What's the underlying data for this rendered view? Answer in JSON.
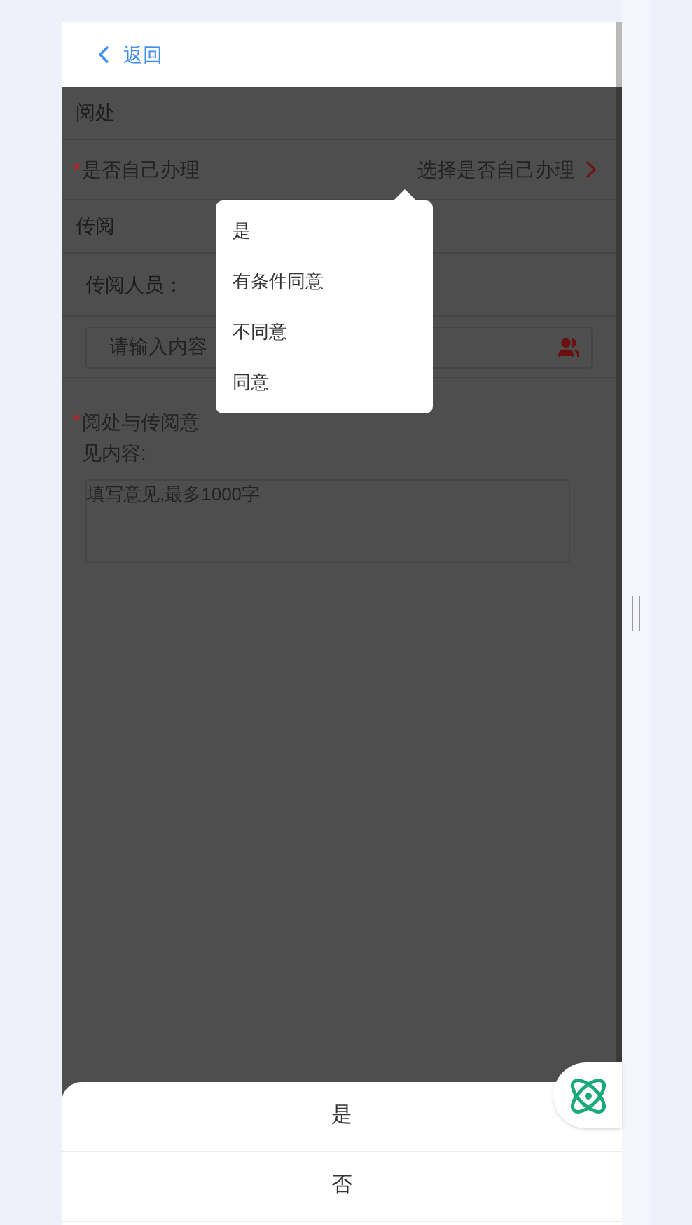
{
  "back": "返回",
  "form": {
    "section_1": "阅处",
    "handle_self": {
      "label": "是否自己办理",
      "required_mark": "*",
      "placeholder": "选择是否自己办理"
    },
    "section_2": "传阅",
    "recipients": {
      "label": "传阅人员：",
      "placeholder": "请输入内容"
    },
    "opinion": {
      "label": "阅处与传阅意见内容:",
      "required_mark": "*",
      "placeholder": "填写意见,最多1000字"
    }
  },
  "popover": {
    "options": [
      "是",
      "有条件同意",
      "不同意",
      "同意"
    ]
  },
  "action_sheet": {
    "options": [
      "是",
      "否"
    ]
  }
}
